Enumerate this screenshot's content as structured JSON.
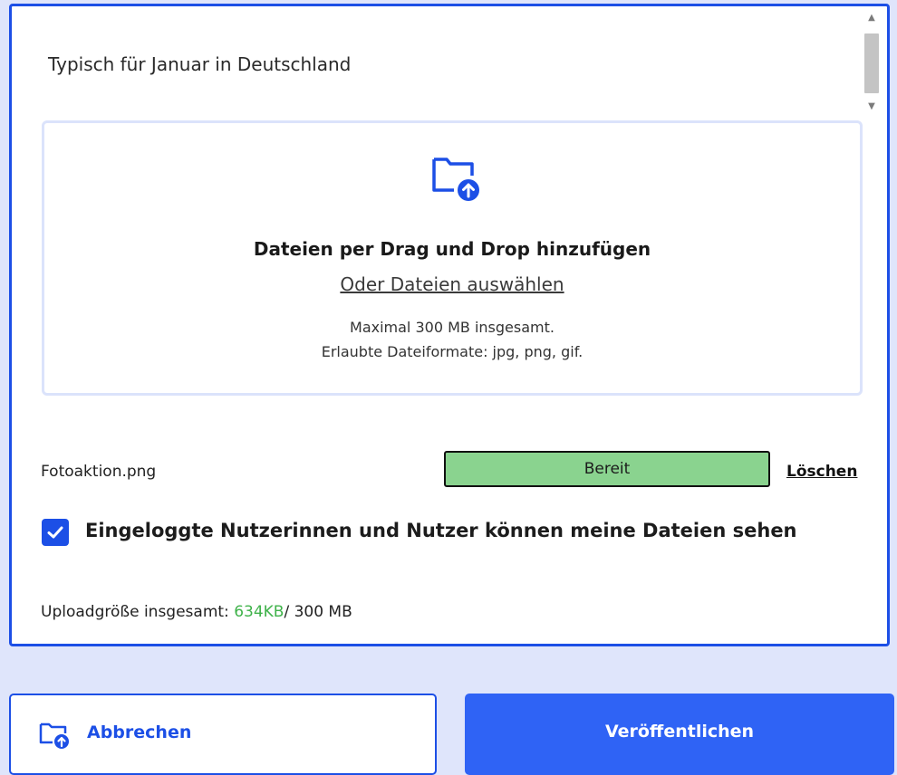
{
  "subtitle": "Typisch für Januar in Deutschland",
  "dropzone": {
    "icon": "folder-upload-icon",
    "title": "Dateien per Drag und Drop hinzufügen",
    "select_link": "Oder Dateien auswählen",
    "max_size_note": "Maximal 300 MB insgesamt.",
    "formats_note": "Erlaubte Dateiformate: jpg, png, gif."
  },
  "file": {
    "name": "Fotoaktion.png",
    "status": "Bereit",
    "status_color": "#8ad38f",
    "delete_label": "Löschen"
  },
  "visibility": {
    "checked": true,
    "label": "Eingeloggte Nutzerinnen und Nutzer können meine Dateien sehen"
  },
  "upload_size": {
    "label": "Uploadgröße insgesamt: ",
    "used": "634KB",
    "limit": "/ 300 MB",
    "used_color": "#3fb24a"
  },
  "buttons": {
    "cancel_label": "Abbrechen",
    "cancel_icon": "folder-upload-icon",
    "publish_label": "Veröffentlichen"
  },
  "colors": {
    "accent": "#1c4fe6",
    "publish": "#2f63f5",
    "background": "#dfe5fb"
  }
}
